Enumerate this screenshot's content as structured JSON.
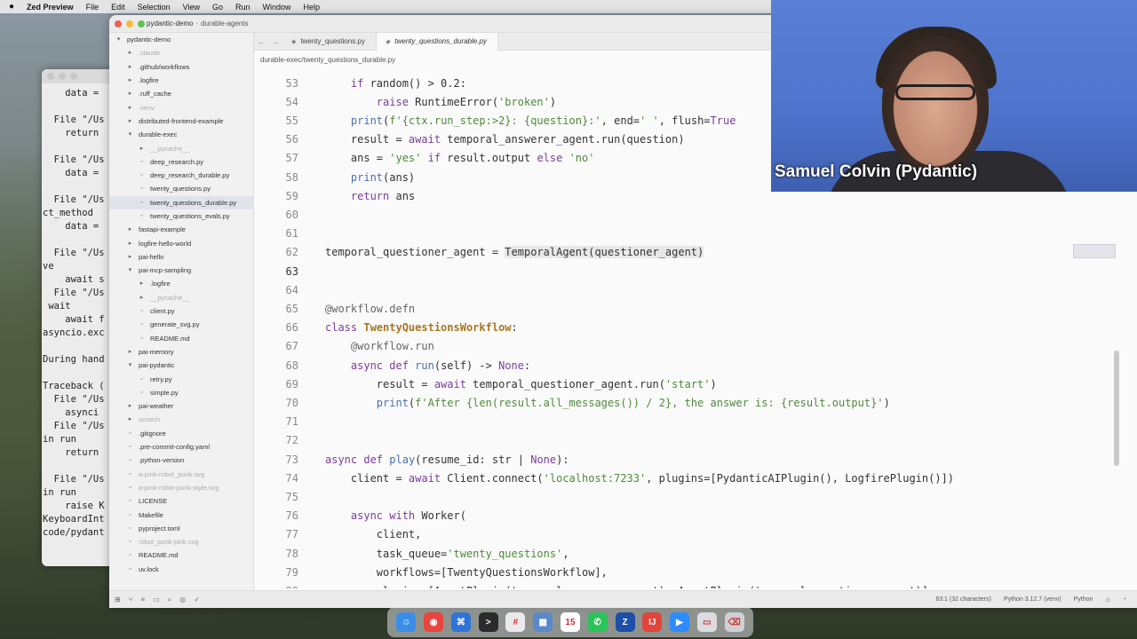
{
  "menubar": {
    "app": "Zed Preview",
    "items": [
      "File",
      "Edit",
      "Selection",
      "View",
      "Go",
      "Run",
      "Window",
      "Help"
    ]
  },
  "terminal": {
    "lines": [
      "    data =",
      "",
      "  File \"/Us",
      "    return",
      "",
      "  File \"/Us",
      "    data =",
      "",
      "  File \"/Us",
      "ct_method",
      "    data =",
      "",
      "  File \"/Us",
      "ve",
      "    await s",
      "  File \"/Us",
      " wait",
      "    await f",
      "asyncio.exc",
      "",
      "During hand",
      "",
      "Traceback (",
      "  File \"/Us",
      "    asynci",
      "  File \"/Us",
      "in run",
      "    return",
      "",
      "  File \"/Us",
      "in run",
      "    raise K",
      "KeyboardInt",
      "code/pydant"
    ]
  },
  "titlebar": {
    "project": "pydantic-demo",
    "branch": "durable-agents"
  },
  "project_panel": {
    "items": [
      {
        "label": "pydantic-demo",
        "depth": 0,
        "kind": "folder-open",
        "dim": false
      },
      {
        "label": ".claude",
        "depth": 1,
        "kind": "folder",
        "dim": true
      },
      {
        "label": ".github/workflows",
        "depth": 1,
        "kind": "folder",
        "dim": false
      },
      {
        "label": ".logfire",
        "depth": 1,
        "kind": "folder",
        "dim": false
      },
      {
        "label": ".ruff_cache",
        "depth": 1,
        "kind": "folder",
        "dim": false
      },
      {
        "label": ".venv",
        "depth": 1,
        "kind": "folder",
        "dim": true
      },
      {
        "label": "distributed-frontend-example",
        "depth": 1,
        "kind": "folder",
        "dim": false
      },
      {
        "label": "durable-exec",
        "depth": 1,
        "kind": "folder-open",
        "dim": false
      },
      {
        "label": "__pycache__",
        "depth": 2,
        "kind": "folder",
        "dim": true
      },
      {
        "label": "deep_research.py",
        "depth": 2,
        "kind": "file",
        "dim": false
      },
      {
        "label": "deep_research_durable.py",
        "depth": 2,
        "kind": "file",
        "dim": false
      },
      {
        "label": "twenty_questions.py",
        "depth": 2,
        "kind": "file",
        "dim": false
      },
      {
        "label": "twenty_questions_durable.py",
        "depth": 2,
        "kind": "file",
        "dim": false,
        "active": true
      },
      {
        "label": "twenty_questions_evals.py",
        "depth": 2,
        "kind": "file",
        "dim": false
      },
      {
        "label": "fastapi-example",
        "depth": 1,
        "kind": "folder",
        "dim": false
      },
      {
        "label": "logfire-hello-world",
        "depth": 1,
        "kind": "folder",
        "dim": false
      },
      {
        "label": "pai-hello",
        "depth": 1,
        "kind": "folder",
        "dim": false
      },
      {
        "label": "pai-mcp-sampling",
        "depth": 1,
        "kind": "folder-open",
        "dim": false
      },
      {
        "label": ".logfire",
        "depth": 2,
        "kind": "folder",
        "dim": false
      },
      {
        "label": "__pycache__",
        "depth": 2,
        "kind": "folder",
        "dim": true
      },
      {
        "label": "client.py",
        "depth": 2,
        "kind": "file",
        "dim": false
      },
      {
        "label": "generate_svg.py",
        "depth": 2,
        "kind": "file",
        "dim": false
      },
      {
        "label": "README.md",
        "depth": 2,
        "kind": "file",
        "dim": false
      },
      {
        "label": "pai-memory",
        "depth": 1,
        "kind": "folder",
        "dim": false
      },
      {
        "label": "pai-pydantic",
        "depth": 1,
        "kind": "folder-open",
        "dim": false
      },
      {
        "label": "retry.py",
        "depth": 2,
        "kind": "file",
        "dim": false
      },
      {
        "label": "simple.py",
        "depth": 2,
        "kind": "file",
        "dim": false
      },
      {
        "label": "pai-weather",
        "depth": 1,
        "kind": "folder",
        "dim": false
      },
      {
        "label": "scratch",
        "depth": 1,
        "kind": "folder",
        "dim": true
      },
      {
        "label": ".gitignore",
        "depth": 1,
        "kind": "file",
        "dim": false
      },
      {
        "label": ".pre-commit-config.yaml",
        "depth": 1,
        "kind": "file",
        "dim": false
      },
      {
        "label": ".python-version",
        "depth": 1,
        "kind": "file",
        "dim": false
      },
      {
        "label": "a-pink-robot_punk.svg",
        "depth": 1,
        "kind": "file",
        "dim": true
      },
      {
        "label": "a-pink-robot-punk-style.svg",
        "depth": 1,
        "kind": "file",
        "dim": true
      },
      {
        "label": "LICENSE",
        "depth": 1,
        "kind": "file",
        "dim": false
      },
      {
        "label": "Makefile",
        "depth": 1,
        "kind": "file",
        "dim": false
      },
      {
        "label": "pyproject.toml",
        "depth": 1,
        "kind": "file",
        "dim": false
      },
      {
        "label": "robot_punk-pink.svg",
        "depth": 1,
        "kind": "file",
        "dim": true
      },
      {
        "label": "README.md",
        "depth": 1,
        "kind": "file",
        "dim": false
      },
      {
        "label": "uv.lock",
        "depth": 1,
        "kind": "file",
        "dim": false
      }
    ]
  },
  "tabs": [
    {
      "label": "twenty_questions.py",
      "active": false
    },
    {
      "label": "twenty_questions_durable.py",
      "active": true
    }
  ],
  "breadcrumb": "durable-exec/twenty_questions_durable.py",
  "code_lines": [
    {
      "n": "53",
      "html": "<span class='kw'>if</span> random() > 0.2:",
      "indent": 4
    },
    {
      "n": "54",
      "html": "<span class='kw'>raise</span> RuntimeError(<span class='str'>'broken'</span>)",
      "indent": 8
    },
    {
      "n": "55",
      "html": "<span class='fn'>print</span>(<span class='str'>f'{ctx.run_step:>2}: {question}:'</span>, end=<span class='str'>' '</span>, flush=<span class='kw'>True</span>",
      "indent": 4
    },
    {
      "n": "56",
      "html": "result = <span class='kw'>await</span> temporal_answerer_agent.run(question)",
      "indent": 4
    },
    {
      "n": "57",
      "html": "ans = <span class='str'>'yes'</span> <span class='kw'>if</span> result.output <span class='kw'>else</span> <span class='str'>'no'</span>",
      "indent": 4
    },
    {
      "n": "58",
      "html": "<span class='fn'>print</span>(ans)",
      "indent": 4
    },
    {
      "n": "59",
      "html": "<span class='kw'>return</span> ans",
      "indent": 4
    },
    {
      "n": "60",
      "html": "",
      "indent": 0
    },
    {
      "n": "61",
      "html": "",
      "indent": 0
    },
    {
      "n": "62",
      "html": "temporal_questioner_agent = <span class='hl'>TemporalAgent(questioner_agent)</span>",
      "indent": 0
    },
    {
      "n": "63",
      "html": "",
      "indent": 0,
      "current": true
    },
    {
      "n": "64",
      "html": "",
      "indent": 0
    },
    {
      "n": "65",
      "html": "<span class='dec'>@workflow.defn</span>",
      "indent": 0
    },
    {
      "n": "66",
      "html": "<span class='kw'>class</span> <span class='cls'>TwentyQuestionsWorkflow</span>:",
      "indent": 0
    },
    {
      "n": "67",
      "html": "<span class='dec'>@workflow.run</span>",
      "indent": 4
    },
    {
      "n": "68",
      "html": "<span class='kw'>async def</span> <span class='fn'>run</span>(self) -> <span class='kw'>None</span>:",
      "indent": 4
    },
    {
      "n": "69",
      "html": "result = <span class='kw'>await</span> temporal_questioner_agent.run(<span class='str'>'start'</span>)",
      "indent": 8
    },
    {
      "n": "70",
      "html": "<span class='fn'>print</span>(<span class='str'>f'After {len(result.all_messages()) / 2}, the answer is: {result.output}'</span>)",
      "indent": 8
    },
    {
      "n": "71",
      "html": "",
      "indent": 0
    },
    {
      "n": "72",
      "html": "",
      "indent": 0
    },
    {
      "n": "73",
      "html": "<span class='kw'>async def</span> <span class='fn'>play</span>(resume_id: str | <span class='kw'>None</span>):",
      "indent": 0
    },
    {
      "n": "74",
      "html": "client = <span class='kw'>await</span> Client.connect(<span class='str'>'localhost:7233'</span>, plugins=[PydanticAIPlugin(), LogfirePlugin()])",
      "indent": 4
    },
    {
      "n": "75",
      "html": "",
      "indent": 0
    },
    {
      "n": "76",
      "html": "<span class='kw'>async with</span> Worker(",
      "indent": 4
    },
    {
      "n": "77",
      "html": "client,",
      "indent": 8
    },
    {
      "n": "78",
      "html": "task_queue=<span class='str'>'twenty_questions'</span>,",
      "indent": 8
    },
    {
      "n": "79",
      "html": "workflows=[TwentyQuestionsWorkflow],",
      "indent": 8
    },
    {
      "n": "80",
      "html": "plugins=[AgentPlugin(temporal_answerer_agent), AgentPlugin(temporal_questioner_agent)],",
      "indent": 8
    }
  ],
  "statusbar": {
    "position": "63:1 (32 characters)",
    "interpreter": "Python 3.12.7 (venv)",
    "language": "Python"
  },
  "webcam": {
    "name": "Samuel Colvin (Pydantic)"
  },
  "dock": {
    "apps": [
      {
        "name": "finder-icon",
        "color": "#3b8ee8",
        "glyph": "☺"
      },
      {
        "name": "chrome-icon",
        "color": "#e8453c",
        "glyph": "◉"
      },
      {
        "name": "xcode-icon",
        "color": "#2f73d9",
        "glyph": "⌘"
      },
      {
        "name": "terminal-icon",
        "color": "#2b2b2b",
        "glyph": ">"
      },
      {
        "name": "slack-icon",
        "color": "#e9e9ee",
        "glyph": "#"
      },
      {
        "name": "preview-icon",
        "color": "#5a89c9",
        "glyph": "▦"
      },
      {
        "name": "calendar-icon",
        "color": "#ffffff",
        "glyph": "15"
      },
      {
        "name": "whatsapp-icon",
        "color": "#2ac45a",
        "glyph": "✆"
      },
      {
        "name": "zed-icon",
        "color": "#1d4fa8",
        "glyph": "Z"
      },
      {
        "name": "intellij-icon",
        "color": "#e0453b",
        "glyph": "IJ"
      },
      {
        "name": "zoom-icon",
        "color": "#2d8cff",
        "glyph": "▶"
      },
      {
        "name": "downloads-icon",
        "color": "#dcdce0",
        "glyph": "▭"
      },
      {
        "name": "trash-icon",
        "color": "#cfcfd4",
        "glyph": "⌫"
      }
    ]
  }
}
